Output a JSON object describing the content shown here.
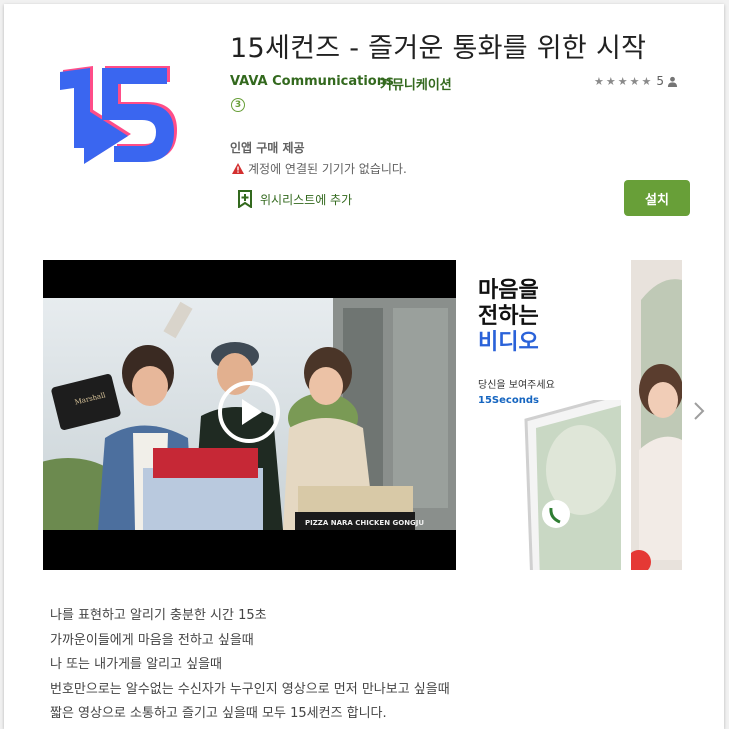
{
  "app": {
    "title": "15세컨즈 - 즐거운 통화를 위한 시작",
    "developer": "VAVA Communications",
    "category": "커뮤니케이션",
    "stars": "★★★★★",
    "rating_count": "5",
    "age_rating": "3",
    "in_app_purchase": "인앱 구매 제공",
    "device_warning": "계정에 연결된 기기가 없습니다.",
    "wishlist_label": "위시리스트에 추가",
    "install_label": "설치"
  },
  "icons": {
    "app_icon": "15-logo-icon",
    "person": "person-icon",
    "warning": "warning-icon",
    "wishlist": "bookmark-add-icon",
    "play": "play-icon",
    "next": "chevron-right-icon"
  },
  "screenshots": {
    "shot1": {
      "line1": "마음을",
      "line2": "전하는",
      "line3": "비디오",
      "subtitle": "당신을 보여주세요",
      "brand": "15Seconds"
    },
    "video_signs": {
      "speaker": "Marshall",
      "box": "PIZZA NARA CHICKEN GONGJU"
    }
  },
  "description": [
    "나를 표현하고 알리기 충분한 시간 15초",
    "가까운이들에게 마음을 전하고 싶을때",
    "나 또는 내가게를 알리고 싶을때",
    "번호만으로는 알수없는 수신자가 누구인지 영상으로 먼저 만나보고 싶을때",
    "짧은 영상으로 소통하고 즐기고 싶을때 모두 15세컨즈 합니다."
  ],
  "colors": {
    "accent_green": "#689f38",
    "text_green": "#33691e",
    "logo_blue": "#3a66f0",
    "logo_pink": "#ff4d88",
    "brand_blue": "#1565c0"
  }
}
